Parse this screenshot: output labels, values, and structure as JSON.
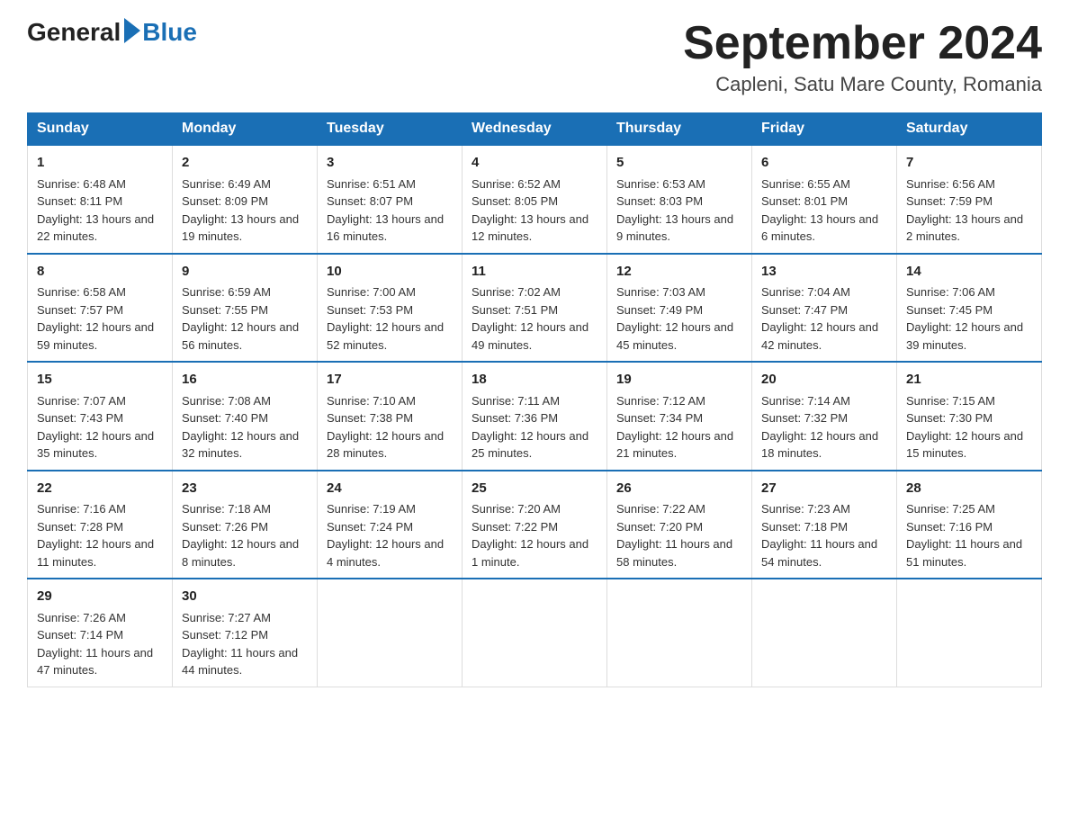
{
  "header": {
    "logo_general": "General",
    "logo_blue": "Blue",
    "month_title": "September 2024",
    "location": "Capleni, Satu Mare County, Romania"
  },
  "days_of_week": [
    "Sunday",
    "Monday",
    "Tuesday",
    "Wednesday",
    "Thursday",
    "Friday",
    "Saturday"
  ],
  "weeks": [
    [
      {
        "day": "1",
        "sunrise": "6:48 AM",
        "sunset": "8:11 PM",
        "daylight": "13 hours and 22 minutes."
      },
      {
        "day": "2",
        "sunrise": "6:49 AM",
        "sunset": "8:09 PM",
        "daylight": "13 hours and 19 minutes."
      },
      {
        "day": "3",
        "sunrise": "6:51 AM",
        "sunset": "8:07 PM",
        "daylight": "13 hours and 16 minutes."
      },
      {
        "day": "4",
        "sunrise": "6:52 AM",
        "sunset": "8:05 PM",
        "daylight": "13 hours and 12 minutes."
      },
      {
        "day": "5",
        "sunrise": "6:53 AM",
        "sunset": "8:03 PM",
        "daylight": "13 hours and 9 minutes."
      },
      {
        "day": "6",
        "sunrise": "6:55 AM",
        "sunset": "8:01 PM",
        "daylight": "13 hours and 6 minutes."
      },
      {
        "day": "7",
        "sunrise": "6:56 AM",
        "sunset": "7:59 PM",
        "daylight": "13 hours and 2 minutes."
      }
    ],
    [
      {
        "day": "8",
        "sunrise": "6:58 AM",
        "sunset": "7:57 PM",
        "daylight": "12 hours and 59 minutes."
      },
      {
        "day": "9",
        "sunrise": "6:59 AM",
        "sunset": "7:55 PM",
        "daylight": "12 hours and 56 minutes."
      },
      {
        "day": "10",
        "sunrise": "7:00 AM",
        "sunset": "7:53 PM",
        "daylight": "12 hours and 52 minutes."
      },
      {
        "day": "11",
        "sunrise": "7:02 AM",
        "sunset": "7:51 PM",
        "daylight": "12 hours and 49 minutes."
      },
      {
        "day": "12",
        "sunrise": "7:03 AM",
        "sunset": "7:49 PM",
        "daylight": "12 hours and 45 minutes."
      },
      {
        "day": "13",
        "sunrise": "7:04 AM",
        "sunset": "7:47 PM",
        "daylight": "12 hours and 42 minutes."
      },
      {
        "day": "14",
        "sunrise": "7:06 AM",
        "sunset": "7:45 PM",
        "daylight": "12 hours and 39 minutes."
      }
    ],
    [
      {
        "day": "15",
        "sunrise": "7:07 AM",
        "sunset": "7:43 PM",
        "daylight": "12 hours and 35 minutes."
      },
      {
        "day": "16",
        "sunrise": "7:08 AM",
        "sunset": "7:40 PM",
        "daylight": "12 hours and 32 minutes."
      },
      {
        "day": "17",
        "sunrise": "7:10 AM",
        "sunset": "7:38 PM",
        "daylight": "12 hours and 28 minutes."
      },
      {
        "day": "18",
        "sunrise": "7:11 AM",
        "sunset": "7:36 PM",
        "daylight": "12 hours and 25 minutes."
      },
      {
        "day": "19",
        "sunrise": "7:12 AM",
        "sunset": "7:34 PM",
        "daylight": "12 hours and 21 minutes."
      },
      {
        "day": "20",
        "sunrise": "7:14 AM",
        "sunset": "7:32 PM",
        "daylight": "12 hours and 18 minutes."
      },
      {
        "day": "21",
        "sunrise": "7:15 AM",
        "sunset": "7:30 PM",
        "daylight": "12 hours and 15 minutes."
      }
    ],
    [
      {
        "day": "22",
        "sunrise": "7:16 AM",
        "sunset": "7:28 PM",
        "daylight": "12 hours and 11 minutes."
      },
      {
        "day": "23",
        "sunrise": "7:18 AM",
        "sunset": "7:26 PM",
        "daylight": "12 hours and 8 minutes."
      },
      {
        "day": "24",
        "sunrise": "7:19 AM",
        "sunset": "7:24 PM",
        "daylight": "12 hours and 4 minutes."
      },
      {
        "day": "25",
        "sunrise": "7:20 AM",
        "sunset": "7:22 PM",
        "daylight": "12 hours and 1 minute."
      },
      {
        "day": "26",
        "sunrise": "7:22 AM",
        "sunset": "7:20 PM",
        "daylight": "11 hours and 58 minutes."
      },
      {
        "day": "27",
        "sunrise": "7:23 AM",
        "sunset": "7:18 PM",
        "daylight": "11 hours and 54 minutes."
      },
      {
        "day": "28",
        "sunrise": "7:25 AM",
        "sunset": "7:16 PM",
        "daylight": "11 hours and 51 minutes."
      }
    ],
    [
      {
        "day": "29",
        "sunrise": "7:26 AM",
        "sunset": "7:14 PM",
        "daylight": "11 hours and 47 minutes."
      },
      {
        "day": "30",
        "sunrise": "7:27 AM",
        "sunset": "7:12 PM",
        "daylight": "11 hours and 44 minutes."
      },
      null,
      null,
      null,
      null,
      null
    ]
  ]
}
